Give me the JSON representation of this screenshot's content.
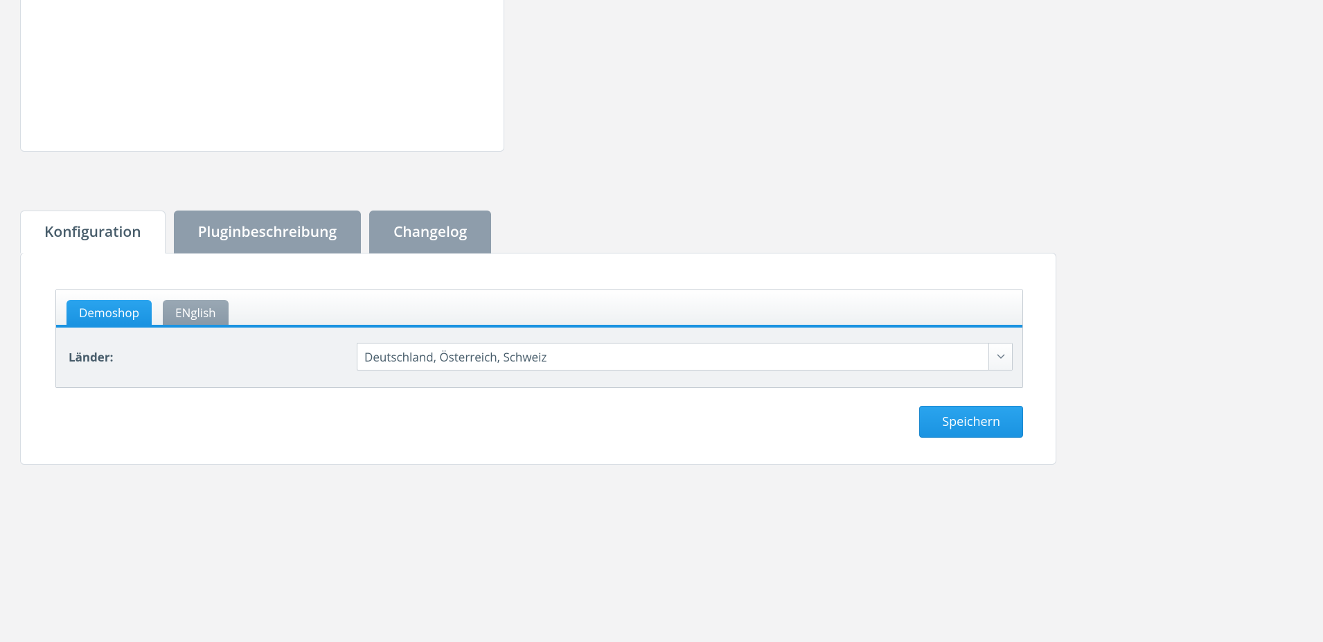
{
  "outerTabs": [
    {
      "label": "Konfiguration",
      "active": true
    },
    {
      "label": "Pluginbeschreibung",
      "active": false
    },
    {
      "label": "Changelog",
      "active": false
    }
  ],
  "innerTabs": [
    {
      "label": "Demoshop",
      "active": true
    },
    {
      "label": "ENglish",
      "active": false
    }
  ],
  "form": {
    "countries": {
      "label": "Länder:",
      "value": "Deutschland, Österreich, Schweiz"
    }
  },
  "actions": {
    "save": "Speichern"
  }
}
